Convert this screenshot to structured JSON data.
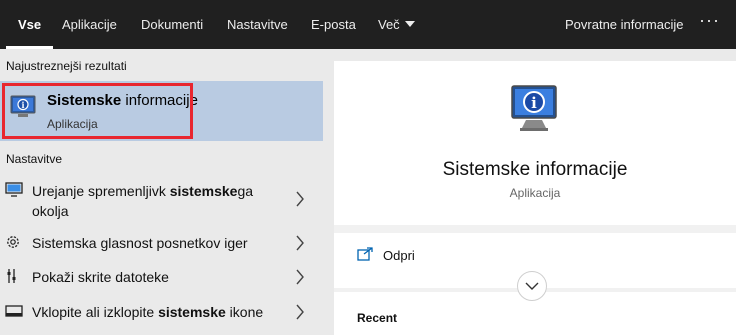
{
  "tabs": [
    {
      "label": "Vse",
      "active": true
    },
    {
      "label": "Aplikacije"
    },
    {
      "label": "Dokumenti"
    },
    {
      "label": "Nastavitve"
    },
    {
      "label": "E-posta"
    },
    {
      "label": "Več"
    }
  ],
  "feedback_label": "Povratne informacije",
  "more_icon": "ellipsis-icon",
  "best_match": {
    "section_label": "Najustreznejši rezultati",
    "title_bold": "Sistemske",
    "title_rest": " informacije",
    "subtitle": "Aplikacija",
    "icon": "system-information-icon"
  },
  "settings": {
    "section_label": "Nastavitve",
    "items": [
      {
        "icon": "monitor-icon",
        "text_pre": "Urejanje spremenljivk ",
        "text_bold": "sistemske",
        "text_post": "ga",
        "text_line2": "okolja"
      },
      {
        "icon": "gear-icon",
        "text_pre": "Sistemska glasnost posnetkov iger",
        "text_bold": "",
        "text_post": ""
      },
      {
        "icon": "toolbar-icon",
        "text_pre": "Pokaži skrite datoteke",
        "text_bold": "",
        "text_post": ""
      },
      {
        "icon": "taskbar-icon",
        "text_pre": "Vklopite ali izklopite ",
        "text_bold": "sistemske",
        "text_post": " ikone"
      }
    ]
  },
  "preview": {
    "title": "Sistemske informacije",
    "subtitle": "Aplikacija",
    "open_label": "Odpri",
    "recent_label": "Recent"
  },
  "colors": {
    "topbar": "#202020",
    "selected": "#b9cbe2",
    "highlight_border": "#e8262f",
    "accent": "#0063b1"
  }
}
